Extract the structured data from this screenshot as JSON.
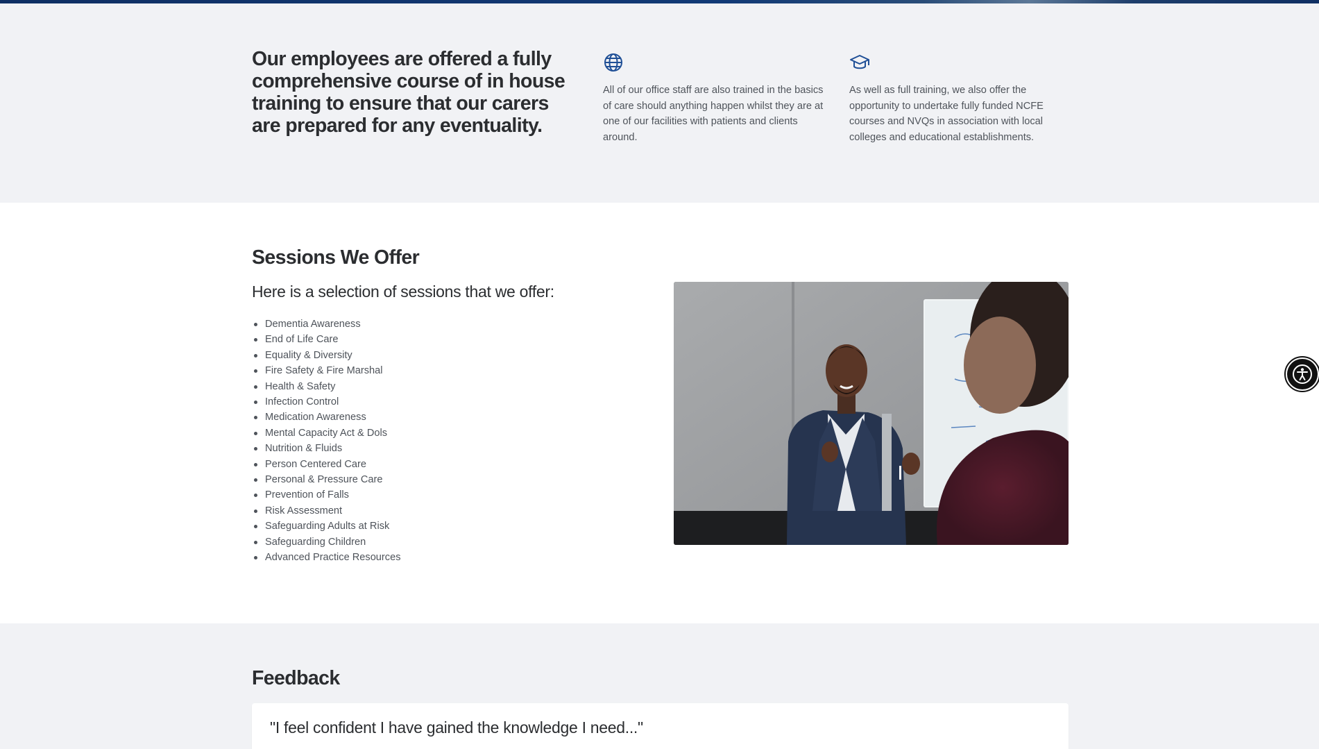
{
  "intro": {
    "heading": "Our employees are offered a fully comprehensive course of in house training to ensure that our carers are prepared for any eventuality.",
    "features": [
      {
        "icon": "globe-icon",
        "text": "All of our office staff are also trained in the basics of care should anything happen whilst they are at one of our facilities with patients and clients around."
      },
      {
        "icon": "graduation-cap-icon",
        "text": "As well as full training, we also offer the opportunity to undertake fully funded NCFE courses and NVQs in association with local colleges and educational establishments."
      }
    ]
  },
  "sessions": {
    "title": "Sessions We Offer",
    "subtitle": "Here is a selection of sessions that we offer:",
    "items": [
      "Dementia Awareness",
      "End of Life Care",
      "Equality & Diversity",
      "Fire Safety & Fire Marshal",
      "Health & Safety",
      "Infection Control",
      "Medication Awareness",
      "Mental Capacity Act & Dols",
      "Nutrition & Fluids",
      "Person Centered Care",
      "Personal & Pressure Care",
      "Prevention of Falls",
      "Risk Assessment",
      "Safeguarding Adults at Risk",
      "Safeguarding Children",
      "Advanced Practice Resources"
    ]
  },
  "feedback": {
    "title": "Feedback",
    "quote": "\"I feel confident I have gained the knowledge I need...\""
  },
  "accessibility": {
    "icon": "accessibility-icon"
  },
  "colors": {
    "accent": "#1f4f96",
    "section_bg": "#f1f2f5",
    "text_dark": "#2b2d30",
    "text_body": "#4e535a"
  }
}
